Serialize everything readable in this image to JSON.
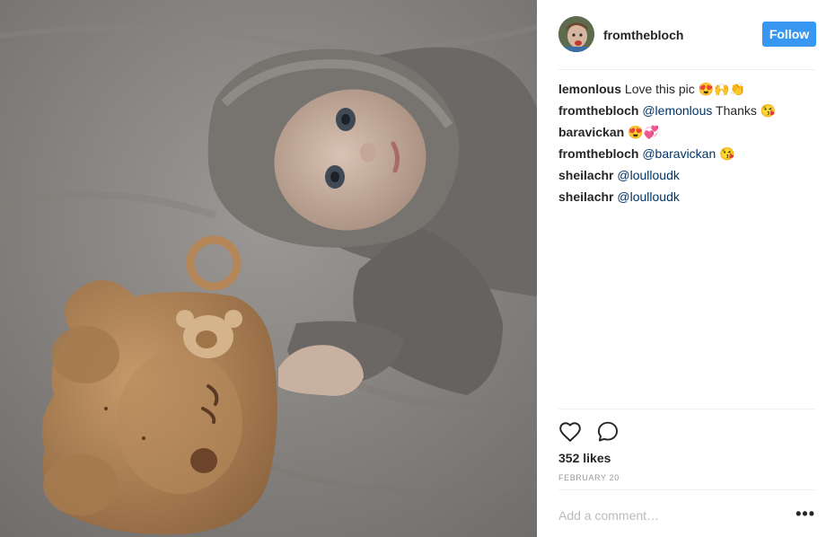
{
  "post": {
    "author": "fromthebloch",
    "follow_label": "Follow",
    "photo_alt": "Baby in a grey hoodie lying next to a wooden bear-shaped plate"
  },
  "comments": [
    {
      "user": "lemonlous",
      "text": "Love this pic",
      "mention": "",
      "emoji": "😍🙌👏"
    },
    {
      "user": "fromthebloch",
      "mention": "@lemonlous",
      "text": "Thanks",
      "emoji": "😘"
    },
    {
      "user": "baravickan",
      "mention": "",
      "text": "",
      "emoji": "😍💞"
    },
    {
      "user": "fromthebloch",
      "mention": "@baravickan",
      "text": "",
      "emoji": "😘"
    },
    {
      "user": "sheilachr",
      "mention": "@loulloudk",
      "text": "",
      "emoji": ""
    },
    {
      "user": "sheilachr",
      "mention": "@loulloudk",
      "text": "",
      "emoji": ""
    }
  ],
  "stats": {
    "likes": "352 likes",
    "date": "FEBRUARY 20"
  },
  "comment_box": {
    "placeholder": "Add a comment…",
    "more": "•••"
  },
  "icons": {
    "like": "heart-icon",
    "comment": "speech-bubble-icon",
    "more": "ellipsis-icon"
  },
  "colors": {
    "follow_button": "#3897f0",
    "mention": "#003569"
  }
}
